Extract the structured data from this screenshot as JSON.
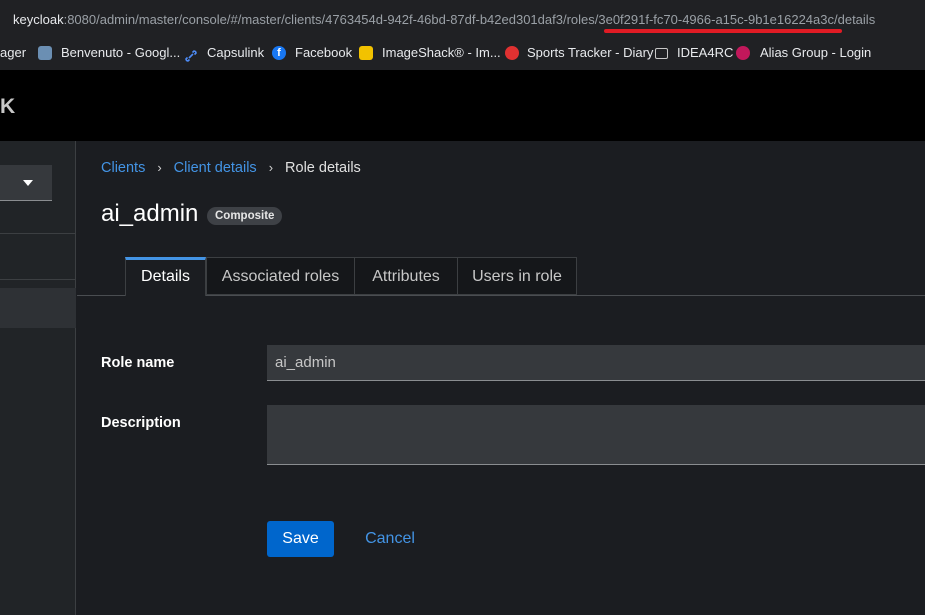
{
  "browser": {
    "url_host": "keycloak",
    "url_rest": ":8080/admin/master/console/#/master/clients/4763454d-942f-46bd-87df-b42ed301daf3/roles/3e0f291f-fc70-4966-a15c-9b1e16224a3c/details",
    "highlight_color": "#e01b24",
    "bookmarks": [
      {
        "label": "ager",
        "icon": null
      },
      {
        "label": "Benvenuto - Googl...",
        "icon": "photo-icon",
        "color": "#6b8fb3"
      },
      {
        "label": "Capsulink",
        "icon": "link-icon",
        "color": "#4d8bf5"
      },
      {
        "label": "Facebook",
        "icon": "facebook-icon",
        "color": "#1877f2"
      },
      {
        "label": "ImageShack® - Im...",
        "icon": "camera-icon",
        "color": "#f2c200"
      },
      {
        "label": "Sports Tracker - Diary",
        "icon": "sports-icon",
        "color": "#e03131"
      },
      {
        "label": "IDEA4RC",
        "icon": "folder-icon"
      },
      {
        "label": "Alias Group - Login",
        "icon": "alias-icon",
        "color": "#c2185b"
      }
    ]
  },
  "header": {
    "logo_fragment": "K"
  },
  "breadcrumb": {
    "items": [
      "Clients",
      "Client details",
      "Role details"
    ],
    "separator": "›"
  },
  "page": {
    "title": "ai_admin",
    "badge": "Composite"
  },
  "tabs": [
    "Details",
    "Associated roles",
    "Attributes",
    "Users in role"
  ],
  "form": {
    "role_name_label": "Role name",
    "role_name_value": "ai_admin",
    "description_label": "Description",
    "description_value": ""
  },
  "actions": {
    "save": "Save",
    "cancel": "Cancel"
  },
  "colors": {
    "accent": "#4394e5",
    "primary_button": "#0066cc"
  }
}
